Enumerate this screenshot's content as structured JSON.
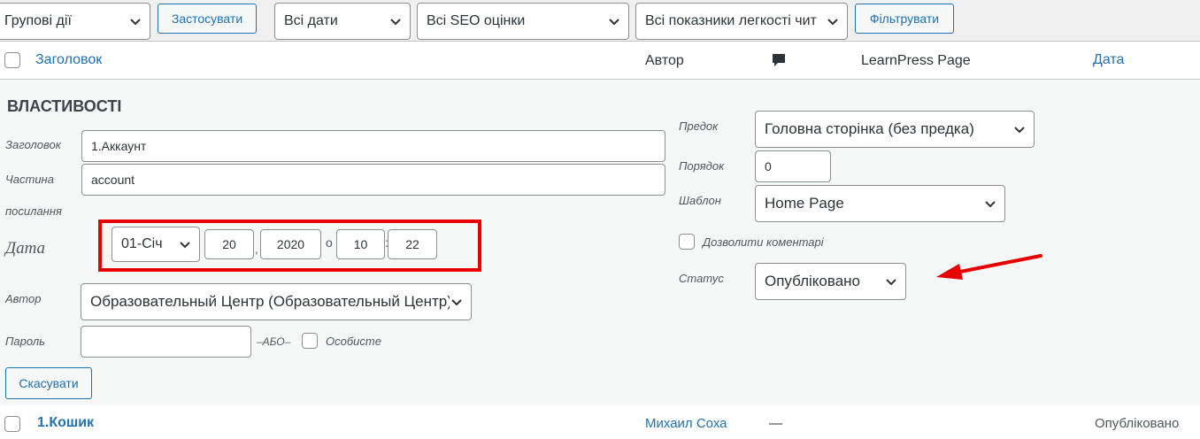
{
  "toolbar": {
    "bulk_actions": "Групові дії",
    "apply": "Застосувати",
    "dates": "Всі дати",
    "seo": "Всі SEO оцінки",
    "readability": "Всі показники легкості чит",
    "filter": "Фільтрувати"
  },
  "columns": {
    "title": "Заголовок",
    "author": "Автор",
    "learnpress": "LearnPress Page",
    "date": "Дата"
  },
  "edit": {
    "heading": "ВЛАСТИВОСТІ",
    "title_label": "Заголовок",
    "title_value": "1.Аккаунт",
    "slug_label_1": "Частина",
    "slug_label_2": "посилання",
    "slug_value": "account",
    "date_label": "Дата",
    "month": "01-Січ",
    "day": "20",
    "year": "2020",
    "at_sep": "о",
    "hour": "10",
    "colon": ":",
    "minute": "22",
    "comma": ",",
    "author_label": "Автор",
    "author_value": "Образовательный Центр (Образовательный Центр)",
    "password_label": "Пароль",
    "password_value": "",
    "or_label": "–АБО–",
    "private_label": "Особисте",
    "cancel": "Скасувати",
    "parent_label": "Предок",
    "parent_value": "Головна сторінка (без предка)",
    "order_label": "Порядок",
    "order_value": "0",
    "template_label": "Шаблон",
    "template_value": "Home Page",
    "allow_comments": "Дозволити коментарі",
    "status_label": "Статус",
    "status_value": "Опубліковано"
  },
  "row": {
    "title": "1.Кошик",
    "author": "Михаил Соха",
    "learnpress": "—",
    "status": "Опубліковано"
  },
  "colors": {
    "accent": "#2271b1",
    "annotation": "#e60000"
  }
}
